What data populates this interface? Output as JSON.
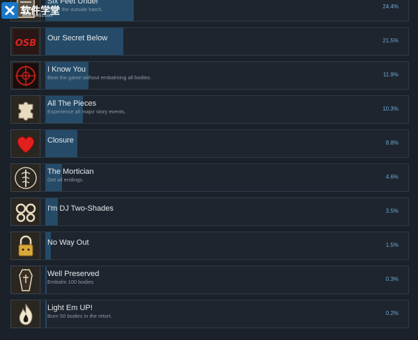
{
  "watermark": {
    "text": "软件学堂",
    "url": "www.xue51.com"
  },
  "colors": {
    "bar": "#264d6b",
    "percent": "#6fa8d6",
    "background": "#1b2129"
  },
  "achievements": [
    {
      "title": "Six Feet Under",
      "description": "Open the outside hatch.",
      "percent": "24.4%",
      "fraction": 0.244,
      "icon": "door-hatch-icon"
    },
    {
      "title": "Our Secret Below",
      "description": "",
      "percent": "21.5%",
      "fraction": 0.215,
      "icon": "osb-graffiti-icon"
    },
    {
      "title": "I Know You",
      "description": "Beat the game without embalming all bodies.",
      "percent": "11.9%",
      "fraction": 0.119,
      "icon": "occult-sigil-icon"
    },
    {
      "title": "All The Pieces",
      "description": "Experience all major story events.",
      "percent": "10.3%",
      "fraction": 0.103,
      "icon": "puzzle-piece-icon"
    },
    {
      "title": "Closure",
      "description": "",
      "percent": "8.8%",
      "fraction": 0.088,
      "icon": "heart-icon"
    },
    {
      "title": "The Mortician",
      "description": "Get all endings.",
      "percent": "4.6%",
      "fraction": 0.046,
      "icon": "caduceus-icon"
    },
    {
      "title": "I'm DJ Two-Shades",
      "description": "",
      "percent": "3.5%",
      "fraction": 0.035,
      "icon": "glasses-icon"
    },
    {
      "title": "No Way Out",
      "description": "",
      "percent": "1.5%",
      "fraction": 0.015,
      "icon": "padlock-icon"
    },
    {
      "title": "Well Preserved",
      "description": "Embalm 100 bodies",
      "percent": "0.3%",
      "fraction": 0.003,
      "icon": "coffin-icon"
    },
    {
      "title": "Light Em UP!",
      "description": "Burn 50 bodies in the retort.",
      "percent": "0.2%",
      "fraction": 0.002,
      "icon": "flame-icon"
    }
  ]
}
